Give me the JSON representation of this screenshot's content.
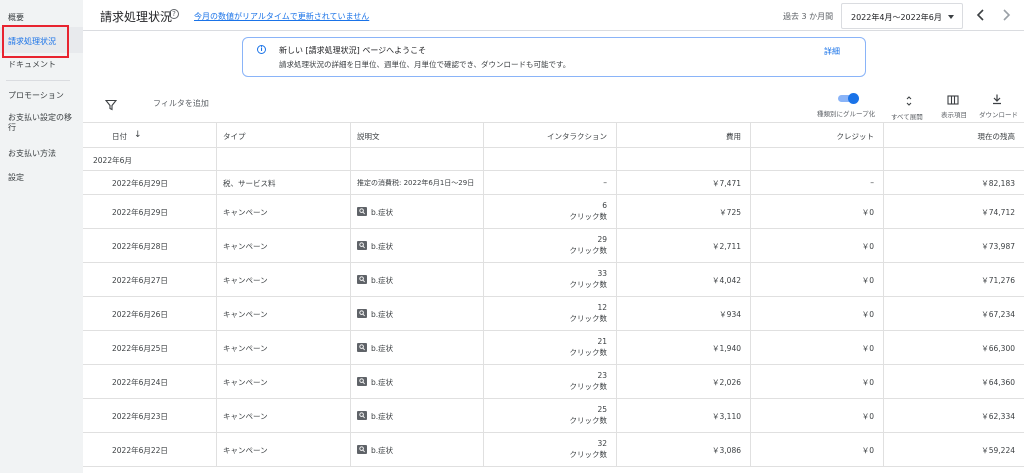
{
  "sidebar": {
    "items": [
      {
        "label": "概要"
      },
      {
        "label": "請求処理状況"
      },
      {
        "label": "ドキュメント"
      },
      {
        "label": "プロモーション"
      },
      {
        "label": "お支払い設定の移行"
      },
      {
        "label": "お支払い方法"
      },
      {
        "label": "設定"
      }
    ]
  },
  "header": {
    "title": "請求処理状況",
    "help_icon": "?",
    "realtime_link": "今月の数値がリアルタイムで更新されていません",
    "period_label": "過去 3 か月間",
    "date_range": "2022年4月～2022年6月"
  },
  "banner": {
    "icon": "i",
    "title": "新しい [請求処理状況] ページへようこそ",
    "body": "請求処理状況の詳細を日単位、週単位、月単位で確認でき、ダウンロードも可能です。",
    "link": "詳細"
  },
  "toolbar": {
    "filter_label": "フィルタを追加",
    "group_by_type_label": "種類別にグループ化",
    "expand_all_label": "すべて展開",
    "columns_label": "表示項目",
    "download_label": "ダウンロード",
    "group_by_type_on": true
  },
  "table": {
    "headers": [
      "日付",
      "タイプ",
      "説明文",
      "インタラクション",
      "費用",
      "クレジット",
      "現在の残高"
    ],
    "sort_arrow": "↓",
    "group_label": "2022年6月",
    "rows": [
      {
        "date": "2022年6月29日",
        "type": "税、サービス料",
        "desc": "推定の消費税: 2022年6月1日～29日",
        "has_icon": false,
        "interactions": "–",
        "interactions_unit": "",
        "cost": "￥7,471",
        "credit": "–",
        "balance": "￥82,183"
      },
      {
        "date": "2022年6月29日",
        "type": "キャンペーン",
        "desc": "b.症状",
        "has_icon": true,
        "interactions": "6",
        "interactions_unit": "クリック数",
        "cost": "￥725",
        "credit": "￥0",
        "balance": "￥74,712"
      },
      {
        "date": "2022年6月28日",
        "type": "キャンペーン",
        "desc": "b.症状",
        "has_icon": true,
        "interactions": "29",
        "interactions_unit": "クリック数",
        "cost": "￥2,711",
        "credit": "￥0",
        "balance": "￥73,987"
      },
      {
        "date": "2022年6月27日",
        "type": "キャンペーン",
        "desc": "b.症状",
        "has_icon": true,
        "interactions": "33",
        "interactions_unit": "クリック数",
        "cost": "￥4,042",
        "credit": "￥0",
        "balance": "￥71,276"
      },
      {
        "date": "2022年6月26日",
        "type": "キャンペーン",
        "desc": "b.症状",
        "has_icon": true,
        "interactions": "12",
        "interactions_unit": "クリック数",
        "cost": "￥934",
        "credit": "￥0",
        "balance": "￥67,234"
      },
      {
        "date": "2022年6月25日",
        "type": "キャンペーン",
        "desc": "b.症状",
        "has_icon": true,
        "interactions": "21",
        "interactions_unit": "クリック数",
        "cost": "￥1,940",
        "credit": "￥0",
        "balance": "￥66,300"
      },
      {
        "date": "2022年6月24日",
        "type": "キャンペーン",
        "desc": "b.症状",
        "has_icon": true,
        "interactions": "23",
        "interactions_unit": "クリック数",
        "cost": "￥2,026",
        "credit": "￥0",
        "balance": "￥64,360"
      },
      {
        "date": "2022年6月23日",
        "type": "キャンペーン",
        "desc": "b.症状",
        "has_icon": true,
        "interactions": "25",
        "interactions_unit": "クリック数",
        "cost": "￥3,110",
        "credit": "￥0",
        "balance": "￥62,334"
      },
      {
        "date": "2022年6月22日",
        "type": "キャンペーン",
        "desc": "b.症状",
        "has_icon": true,
        "interactions": "32",
        "interactions_unit": "クリック数",
        "cost": "￥3,086",
        "credit": "￥0",
        "balance": "￥59,224"
      }
    ]
  },
  "colors": {
    "accent": "#1a73e8",
    "highlight_box": "#e8232f",
    "sidebar_bg": "#f1f3f4"
  },
  "icons": {
    "filter": "filter-icon",
    "expand": "unfold-icon",
    "columns": "columns-icon",
    "download": "download-icon",
    "search": "search-icon"
  }
}
